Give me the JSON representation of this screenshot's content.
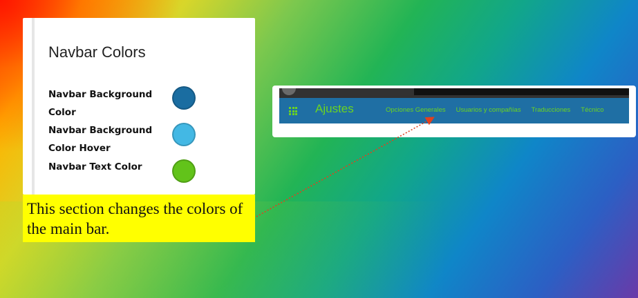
{
  "settings_panel": {
    "title": "Navbar Colors",
    "rows": [
      {
        "label": "Navbar Background Color",
        "color": "#1a6da1"
      },
      {
        "label": "Navbar Background Color Hover",
        "color": "#43b8e4"
      },
      {
        "label": "Navbar Text Color",
        "color": "#62c31a"
      }
    ]
  },
  "caption": "This section changes the colors of the main bar.",
  "navbar_preview": {
    "brand": "Ajustes",
    "menu": [
      "Opciones Generales",
      "Usuarios y compañías",
      "Traducciones",
      "Técnico"
    ],
    "background_color": "#1f6fa4",
    "text_color": "#6cd420",
    "app_menu_icon": "grid-icon"
  },
  "arrow_color": "#e2401e"
}
